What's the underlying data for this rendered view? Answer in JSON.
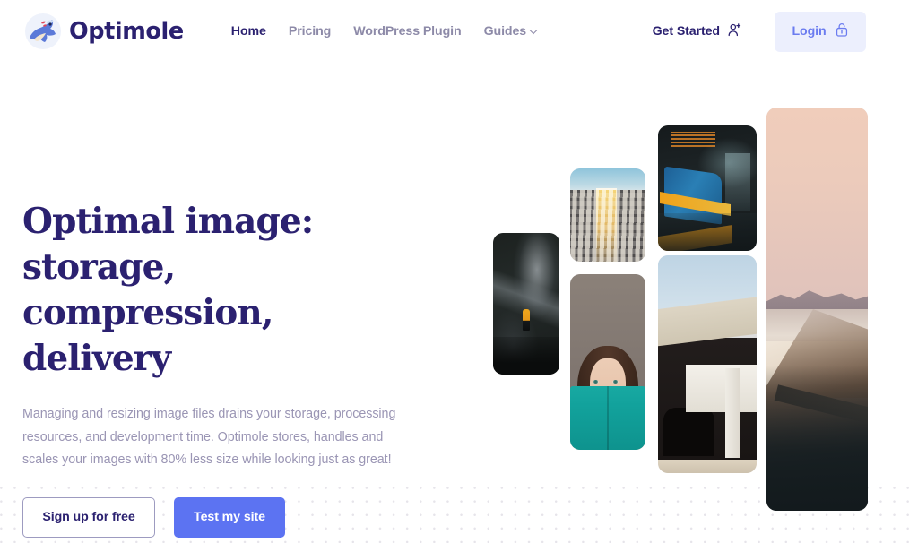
{
  "brand": {
    "name": "Optimole",
    "logo_icon": "mole-mascot-logo",
    "color": "#2b2170"
  },
  "nav": {
    "items": [
      {
        "label": "Home",
        "active": true,
        "has_caret": false
      },
      {
        "label": "Pricing",
        "active": false,
        "has_caret": false
      },
      {
        "label": "WordPress Plugin",
        "active": false,
        "has_caret": false
      },
      {
        "label": "Guides",
        "active": false,
        "has_caret": true
      }
    ]
  },
  "header_actions": {
    "get_started": {
      "label": "Get Started",
      "icon": "user-plus-icon"
    },
    "login": {
      "label": "Login",
      "icon": "padlock-open-icon",
      "bg": "#eceffd",
      "fg": "#6b7cf0"
    }
  },
  "hero": {
    "title": "Optimal image: storage, compression, delivery",
    "subtitle": "Managing and resizing image files drains your storage, processing resources, and development time. Optimole stores, handles and scales your images with 80% less size while looking just as great!",
    "primary_cta": {
      "label": "Test my site",
      "bg": "#5c73f2",
      "fg": "#ffffff"
    },
    "secondary_cta": {
      "label": "Sign up for free",
      "border": "#9d9bc0",
      "fg": "#2b2170"
    }
  },
  "collage": {
    "photos": [
      {
        "id": "ph-cave",
        "alt": "explorer-in-cave-photo"
      },
      {
        "id": "ph-building",
        "alt": "building-facade-sunlight-photo"
      },
      {
        "id": "ph-girl",
        "alt": "woman-reading-teal-book-photo"
      },
      {
        "id": "ph-train",
        "alt": "train-at-station-photo"
      },
      {
        "id": "ph-arch",
        "alt": "modern-architecture-photo"
      },
      {
        "id": "ph-coast",
        "alt": "coastal-cliff-sunset-photo"
      }
    ]
  },
  "decor": {
    "dot_pattern_color": "#e6e4ea"
  }
}
